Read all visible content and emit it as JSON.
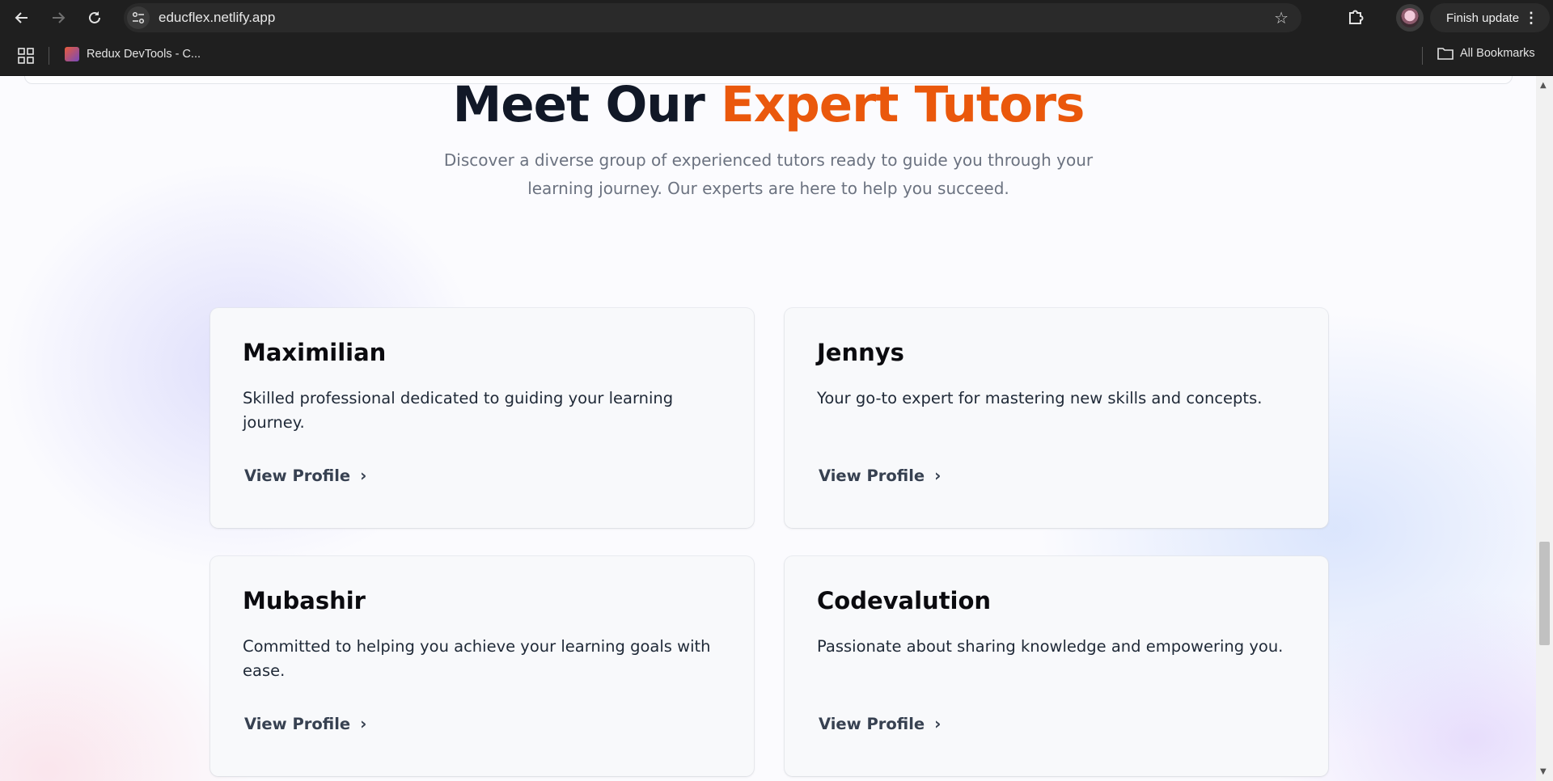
{
  "browser": {
    "url": "educflex.netlify.app",
    "update_label": "Finish update",
    "bookmarks": [
      {
        "label": "Redux DevTools - C..."
      }
    ],
    "all_bookmarks_label": "All Bookmarks"
  },
  "section": {
    "title_part1": "Meet Our ",
    "title_accent": "Expert Tutors",
    "subtitle_line1": "Discover a diverse group of experienced tutors ready to guide you through your",
    "subtitle_line2": "learning journey. Our experts are here to help you succeed."
  },
  "tutors": [
    {
      "name": "Maximilian",
      "description": "Skilled professional dedicated to guiding your learning journey.",
      "link_label": "View Profile"
    },
    {
      "name": "Jennys",
      "description": "Your go-to expert for mastering new skills and concepts.",
      "link_label": "View Profile"
    },
    {
      "name": "Mubashir",
      "description": "Committed to helping you achieve your learning goals with ease.",
      "link_label": "View Profile"
    },
    {
      "name": "Codevalution",
      "description": "Passionate about sharing knowledge and empowering you.",
      "link_label": "View Profile"
    }
  ],
  "colors": {
    "accent": "#ea580c",
    "heading": "#111827",
    "chrome_bg": "#1f1f1f"
  }
}
